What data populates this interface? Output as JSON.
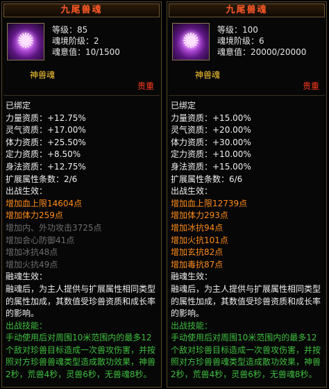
{
  "panels": [
    {
      "title": "九尾兽魂",
      "level": "等级：85",
      "tier": "魂境阶级：2",
      "soul_value": "魂意值：10/1500",
      "soul_type": "神兽魂",
      "rarity": "贵重",
      "bound": "已绑定",
      "attrs": [
        "力量资质：+12.75%",
        "灵气资质：+17.00%",
        "体力资质：+25.50%",
        "定力资质：+8.50%",
        "身法资质：+12.75%"
      ],
      "ext_count": "扩展属性条数：2/6",
      "effect_title": "出战生效：",
      "effects_active": [
        "增加血上限14604点",
        "增加体力259点"
      ],
      "effects_inactive": [
        "增加内、外功攻击3725点",
        "增加会心防御41点",
        "增加冰抗48点",
        "增加火抗49点"
      ],
      "fusion_title": "融魂生效：",
      "fusion_desc": "融魂后，为主人提供与扩展属性相同类型的属性加成，其数值受珍兽资质和成长率的影响。",
      "skill_title": "出战技能：",
      "skill_desc": "手动使用后对周围10米范围内的最多12个敌对珍兽目标造成一次兽攻伤害，并按照对方珍兽兽魂类型造成散功效果，神兽2秒，荒兽4秒，灵兽6秒，无兽魂8秒。"
    },
    {
      "title": "九尾兽魂",
      "level": "等级：100",
      "tier": "魂境阶级：6",
      "soul_value": "魂意值：20000/20000",
      "soul_type": "神兽魂",
      "rarity": "贵重",
      "bound": "已绑定",
      "attrs": [
        "力量资质：+15.00%",
        "灵气资质：+20.00%",
        "体力资质：+30.00%",
        "定力资质：+10.00%",
        "身法资质：+15.00%"
      ],
      "ext_count": "扩展属性条数：6/6",
      "effect_title": "出战生效：",
      "effects_active": [
        "增加血上限12739点",
        "增加体力293点",
        "增加冰抗94点",
        "增加火抗101点",
        "增加玄抗82点",
        "增加毒抗87点"
      ],
      "effects_inactive": [],
      "fusion_title": "融魂生效：",
      "fusion_desc": "融魂后，为主人提供与扩展属性相同类型的属性加成，其数值受珍兽资质和成长率的影响。",
      "skill_title": "出战技能：",
      "skill_desc": "手动使用后对周围10米范围内的最多12个敌对珍兽目标造成一次兽攻伤害，并按照对方珍兽兽魂类型造成散功效果，神兽2秒，荒兽4秒，灵兽6秒，无兽魂8秒。"
    }
  ]
}
